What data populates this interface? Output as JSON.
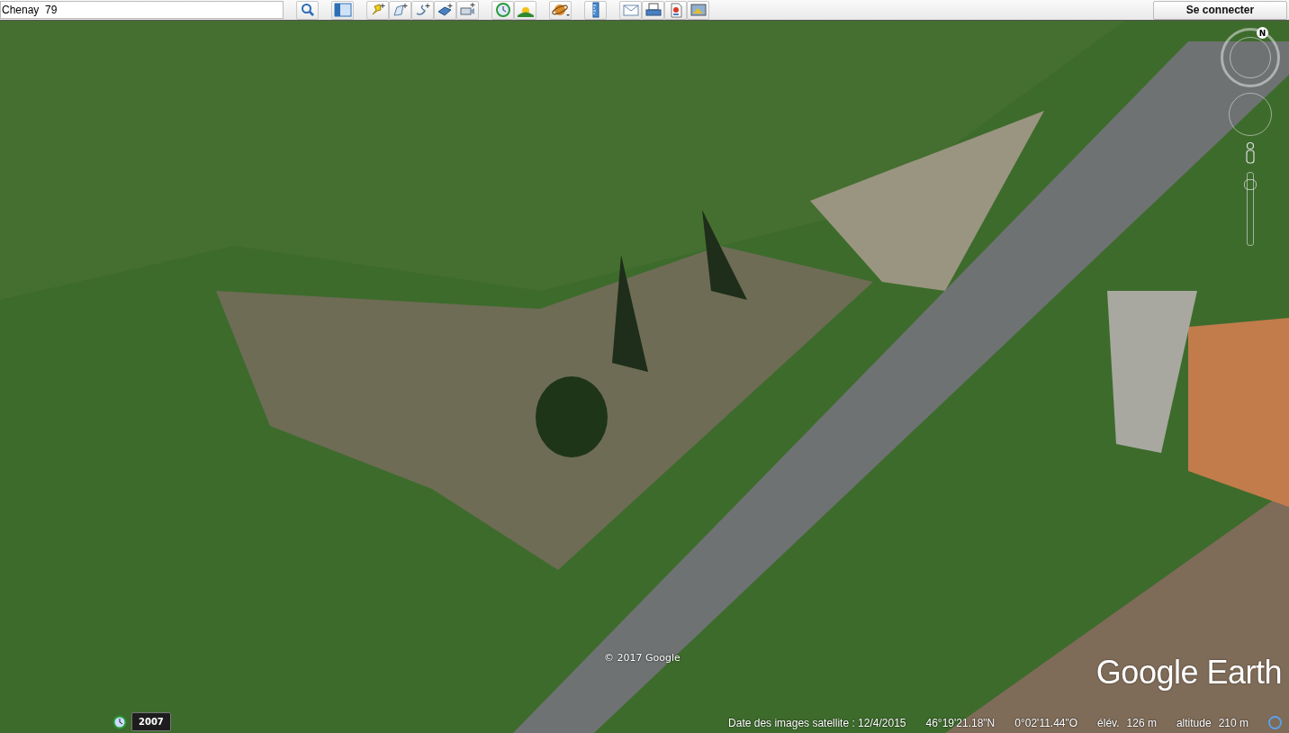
{
  "search": {
    "value": "Chenay  79"
  },
  "sign_in_button": "Se connecter",
  "map": {
    "compass_north": "N",
    "zoom": {
      "level": 0.9
    },
    "copyright": "© 2017 Google",
    "logo": "Google Earth"
  },
  "historical_imagery": {
    "year": "2007"
  },
  "status_bar": {
    "imagery_date": "Date des images satellite : 12/4/2015",
    "latitude": "46°19'21.18\"N",
    "longitude": "0°02'11.44\"O",
    "readings": [
      {
        "label": "élév.",
        "value": "126 m"
      },
      {
        "label": "altitude",
        "value": "210 m"
      }
    ]
  }
}
